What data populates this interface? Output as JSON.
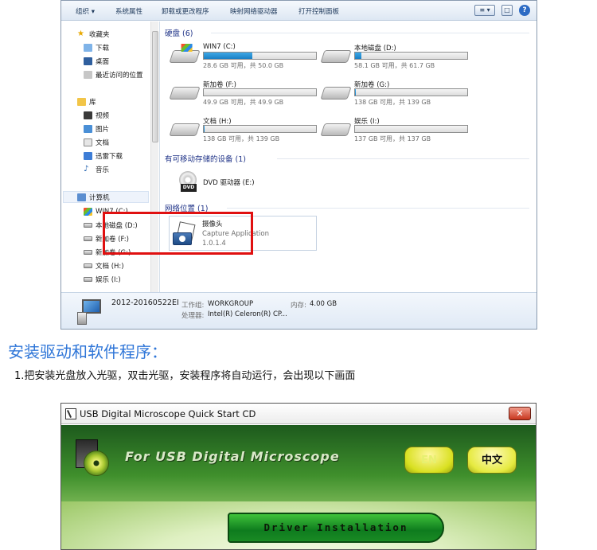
{
  "explorer": {
    "toolbar": {
      "organize": "组织 ▾",
      "system_properties": "系统属性",
      "uninstall": "卸载或更改程序",
      "map_drive": "映射网络驱动器",
      "control_panel": "打开控制面板",
      "view_icon": "≡ ▾",
      "pane_icon": "□",
      "help_icon": "?"
    },
    "nav": {
      "favorites": "收藏夹",
      "downloads": "下载",
      "desktop": "桌面",
      "recent": "最近访问的位置",
      "libraries": "库",
      "videos": "视频",
      "pictures": "图片",
      "documents": "文档",
      "thunder": "迅雷下载",
      "music": "音乐",
      "computer": "计算机",
      "c": "WIN7 (C:)",
      "d": "本地磁盘 (D:)",
      "f": "新加卷 (F:)",
      "g": "新加卷 (G:)",
      "h": "文档 (H:)",
      "i": "娱乐 (I:)"
    },
    "groups": {
      "hdd": "硬盘 (6)",
      "removable": "有可移动存储的设备 (1)",
      "network": "网络位置 (1)"
    },
    "drives": [
      {
        "name": "WIN7 (C:)",
        "size": "28.6 GB 可用，共 50.0 GB",
        "used": 0.43
      },
      {
        "name": "本地磁盘 (D:)",
        "size": "58.1 GB 可用，共 61.7 GB",
        "used": 0.06
      },
      {
        "name": "新加卷 (F:)",
        "size": "49.9 GB 可用，共 49.9 GB",
        "used": 0.0
      },
      {
        "name": "新加卷 (G:)",
        "size": "138 GB 可用，共 139 GB",
        "used": 0.01
      },
      {
        "name": "文档 (H:)",
        "size": "138 GB 可用，共 139 GB",
        "used": 0.01
      },
      {
        "name": "娱乐 (I:)",
        "size": "137 GB 可用，共 137 GB",
        "used": 0.0
      }
    ],
    "dvd": {
      "label": "DVD 驱动器 (E:)",
      "badge": "DVD"
    },
    "camera": {
      "name": "摄像头",
      "app": "Capture Application",
      "version": "1.0.1.4"
    },
    "details": {
      "pc_name": "2012-20160522EI",
      "workgroup_label": "工作组:",
      "workgroup": "WORKGROUP",
      "memory_label": "内存:",
      "memory": "4.00 GB",
      "cpu_label": "处理器:",
      "cpu": "Intel(R) Celeron(R) CP..."
    }
  },
  "section": {
    "title": "安装驱动和软件程序：",
    "step": "1.把安装光盘放入光驱，双击光驱，安装程序将自动运行，会出现以下画面"
  },
  "cd_window": {
    "title": "USB Digital Microscope Quick Start CD",
    "close": "✕",
    "heading": "For USB Digital Microscope",
    "btn_en": "EN",
    "btn_cn": "中文",
    "btn_driver": "Driver Installation"
  }
}
